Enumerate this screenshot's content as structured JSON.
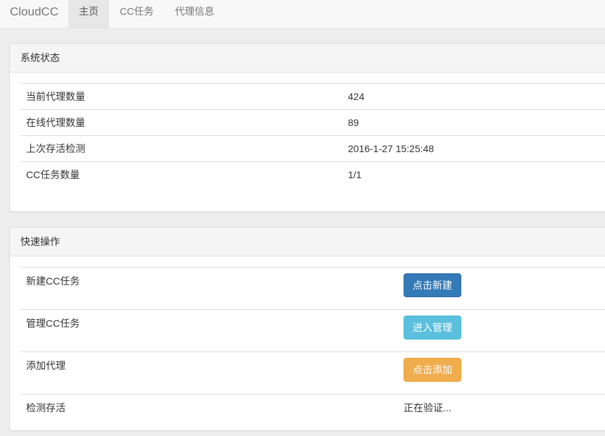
{
  "nav": {
    "brand": "CloudCC",
    "tabs": [
      {
        "label": "主页",
        "active": true
      },
      {
        "label": "CC任务",
        "active": false
      },
      {
        "label": "代理信息",
        "active": false
      }
    ]
  },
  "status_panel": {
    "title": "系统状态",
    "rows": [
      {
        "label": "当前代理数量",
        "value": "424"
      },
      {
        "label": "在线代理数量",
        "value": "89"
      },
      {
        "label": "上次存活检测",
        "value": "2016-1-27 15:25:48"
      },
      {
        "label": "CC任务数量",
        "value": "1/1"
      }
    ]
  },
  "ops_panel": {
    "title": "快速操作",
    "rows": [
      {
        "label": "新建CC任务",
        "button": "点击新建"
      },
      {
        "label": "管理CC任务",
        "button": "进入管理"
      },
      {
        "label": "添加代理",
        "button": "点击添加"
      },
      {
        "label": "检测存活",
        "status": "正在验证..."
      }
    ]
  },
  "colors": {
    "primary": "#337ab7",
    "info": "#5bc0de",
    "warning": "#f0ad4e"
  }
}
